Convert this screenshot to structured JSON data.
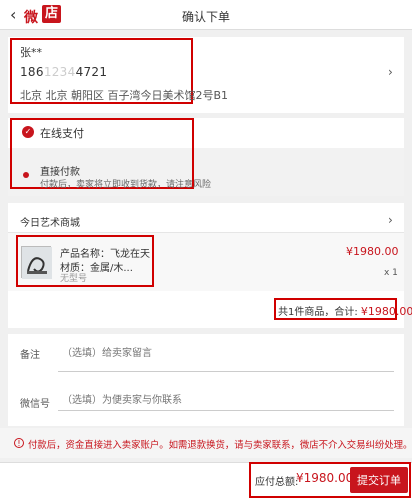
{
  "header": {
    "back_icon": "chevron-left-icon",
    "logo_part1": "微",
    "logo_part2": "店",
    "title": "确认下单"
  },
  "address": {
    "name": "张**",
    "phone_prefix": "186",
    "phone_blur": "1234",
    "phone_suffix": "4721",
    "full_address": "北京 北京 朝阳区 百子湾今日美术馆2号B1",
    "chevron_icon": "chevron-right-icon"
  },
  "payment": {
    "online_label": "在线支付",
    "direct_label": "直接付款",
    "direct_desc": "付款后，卖家将立即收到货款，请注意风险"
  },
  "store": {
    "name": "今日艺术商城",
    "product": {
      "name": "产品名称：飞龙在天",
      "material": "材质：金属/木...",
      "variant": "无型号",
      "price": "¥1980.00",
      "qty": "x 1"
    },
    "total_label": "共1件商品，合计:",
    "total_amount": "¥1980.00"
  },
  "remarks": {
    "remark_label": "备注",
    "remark_placeholder": "（选填）给卖家留言",
    "wechat_label": "微信号",
    "wechat_placeholder": "（选填）为便卖家与你联系"
  },
  "notice": {
    "icon": "exclamation-icon",
    "text": "付款后，资金直接进入卖家账户。如需退款换货，请与卖家联系，微店不介入交易纠纷处理。"
  },
  "footer": {
    "total_label": "应付总额:",
    "total_amount": "¥1980.00",
    "submit_label": "提交订单"
  },
  "colors": {
    "accent": "#c8151d",
    "annotation_box": "#d00000"
  }
}
